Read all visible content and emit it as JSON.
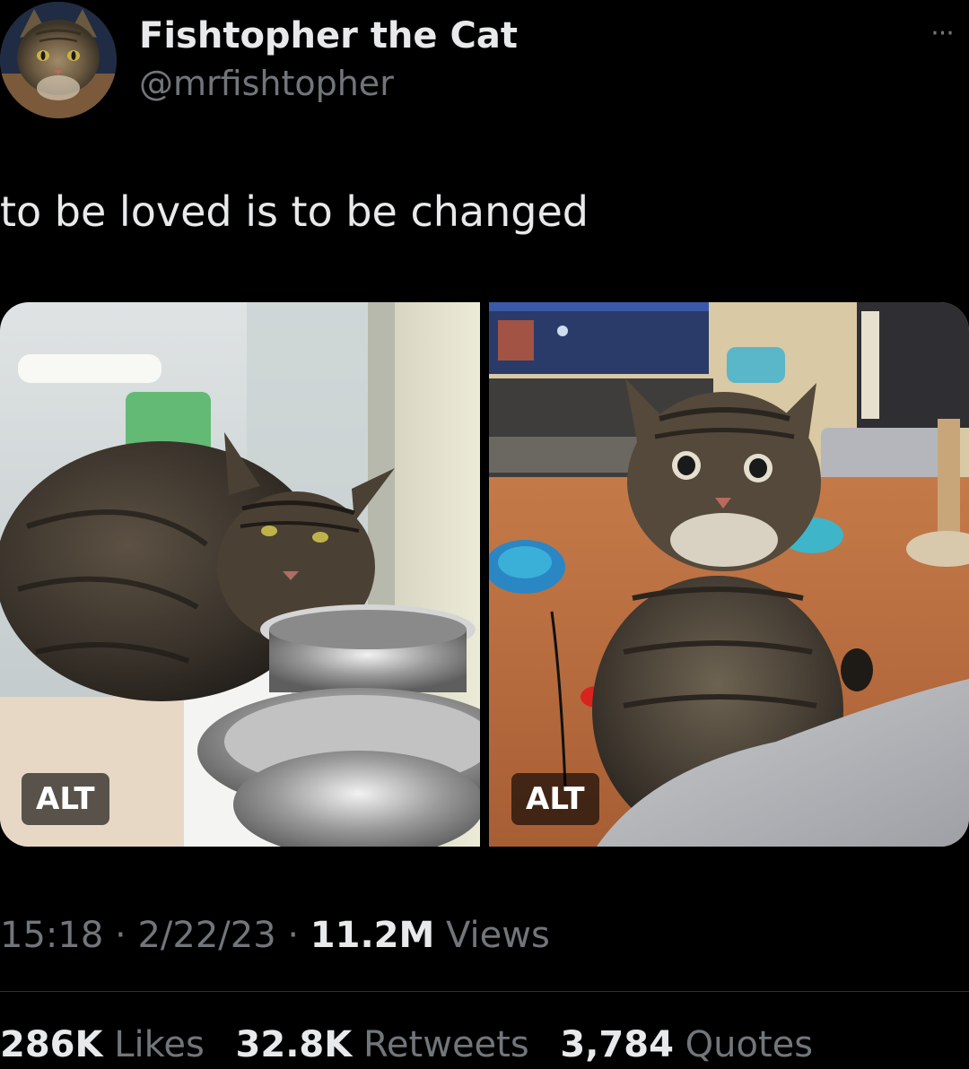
{
  "author": {
    "display_name": "Fishtopher the Cat",
    "handle": "@mrfishtopher"
  },
  "more_menu": {
    "icon": "more-horizontal-icon",
    "label": "···"
  },
  "tweet": {
    "text": "to be loved is to be changed"
  },
  "media": [
    {
      "alt_label": "ALT"
    },
    {
      "alt_label": "ALT"
    }
  ],
  "meta": {
    "time": "15:18",
    "separator": "·",
    "date": "2/22/23",
    "views_count": "11.2M",
    "views_label": "Views"
  },
  "stats": {
    "likes_count": "286K",
    "likes_label": "Likes",
    "retweets_count": "32.8K",
    "retweets_label": "Retweets",
    "quotes_count": "3,784",
    "quotes_label": "Quotes"
  },
  "colors": {
    "background": "#000000",
    "primary_text": "#e7e9ea",
    "secondary_text": "#71767b",
    "divider": "#2f3336"
  }
}
